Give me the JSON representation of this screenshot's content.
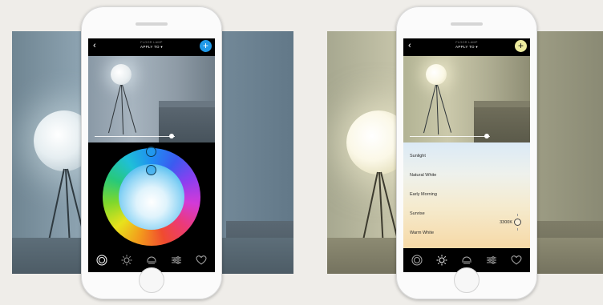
{
  "colors": {
    "accent_blue": "#2199e8",
    "accent_yellow": "#ecea9e",
    "background": "#efede9"
  },
  "phones": [
    {
      "id": "color",
      "nav": {
        "subtitle": "FLOOR LAMP",
        "title": "APPLY TO ▾",
        "back_label": "‹",
        "add_label": "+"
      },
      "brightness": 0.96,
      "mode": "color-wheel",
      "tabs": [
        {
          "name": "color-wheel-tab-icon",
          "active": true
        },
        {
          "name": "white-temperature-tab-icon",
          "active": false
        },
        {
          "name": "scene-tab-icon",
          "active": false
        },
        {
          "name": "settings-sliders-tab-icon",
          "active": false
        },
        {
          "name": "favorites-heart-tab-icon",
          "active": false
        }
      ]
    },
    {
      "id": "white",
      "nav": {
        "subtitle": "FLOOR LAMP",
        "title": "APPLY TO ▾",
        "back_label": "‹",
        "add_label": "+"
      },
      "brightness": 0.96,
      "mode": "white-presets",
      "presets": [
        "Sunlight",
        "Natural White",
        "Early Morning",
        "Sunrise",
        "Warm White"
      ],
      "selected_value": "3300K",
      "tabs": [
        {
          "name": "color-wheel-tab-icon",
          "active": false
        },
        {
          "name": "white-temperature-tab-icon",
          "active": true
        },
        {
          "name": "scene-tab-icon",
          "active": false
        },
        {
          "name": "settings-sliders-tab-icon",
          "active": false
        },
        {
          "name": "favorites-heart-tab-icon",
          "active": false
        }
      ]
    }
  ]
}
